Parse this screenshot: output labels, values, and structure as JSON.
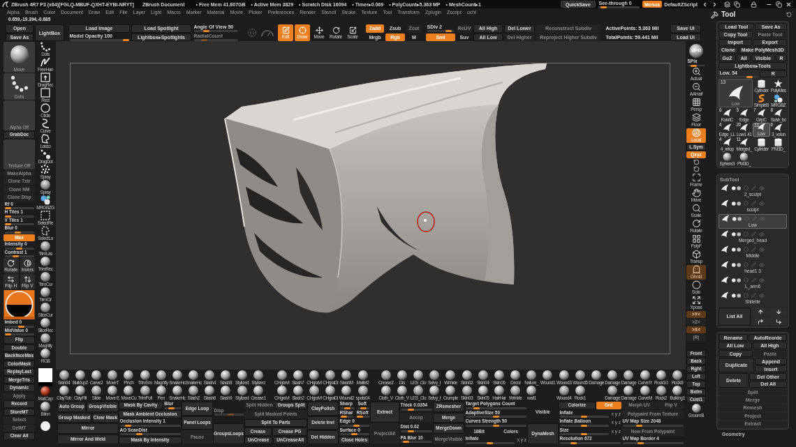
{
  "title_bar": {
    "app_title": "ZBrush 4R7 P3 (x64)[FGLQ-MBUF-QXHT-EYBI-NRYT]",
    "document": "ZBrush Document",
    "stats": [
      "• Free Mem 41.807GB",
      "• Active Mem 3829",
      "• Scratch Disk 16094",
      "• Timer▸0.069",
      "• PolyCount▸5.363 MP",
      "• MeshCount▸1"
    ],
    "quicksave": "QuickSave",
    "see_through": {
      "label": "See-through 0",
      "level": 0.05
    },
    "menus": {
      "label": "Menus",
      "on": true
    },
    "script": "DefaultZScript"
  },
  "menu_bar": [
    "Alpha",
    "Brush",
    "Color",
    "Document",
    "Draw",
    "Edit",
    "File",
    "Layer",
    "Light",
    "Macro",
    "Marker",
    "Material",
    "Movie",
    "Picker",
    "Preferences",
    "Render",
    "Stencil",
    "Stroke",
    "Texture",
    "Tool",
    "Transform",
    "Zplugin",
    "Zscript",
    "ochl"
  ],
  "coordinates": "0.659,-19.394,-0.685",
  "top_shelf": {
    "left": [
      [
        [
          {
            "kind": "button",
            "label": "Open"
          }
        ],
        [
          {
            "kind": "button",
            "label": "Save As"
          }
        ]
      ],
      [
        [
          {
            "kind": "button",
            "label": "LightBox"
          }
        ]
      ],
      [
        [
          {
            "kind": "button",
            "label": "Load Image"
          }
        ],
        [
          {
            "kind": "slider",
            "label": "Model Opacity 100",
            "level": 1
          }
        ]
      ],
      [
        [
          {
            "kind": "button",
            "label": "Load Spotlight"
          }
        ],
        [
          {
            "kind": "button",
            "label": "Lightbox▸Spotlights"
          }
        ]
      ],
      [
        [
          {
            "kind": "slider",
            "label": "Angle Of View 50",
            "level": 0.25
          }
        ],
        [
          {
            "kind": "disabledslider",
            "label": "RadialCount",
            "level": 0.2
          }
        ]
      ]
    ],
    "tools": [
      {
        "label": "Edit",
        "selected": true
      },
      {
        "label": "Draw",
        "selected": true
      },
      {
        "label": "Move",
        "selected": false
      },
      {
        "label": "Rotate",
        "selected": false
      },
      {
        "label": "Scale",
        "selected": false
      }
    ],
    "right": [
      [
        [
          {
            "kind": "active",
            "label": "Zadd"
          }
        ],
        [
          {
            "kind": "plain",
            "label": "Mrgb"
          }
        ]
      ],
      [
        [
          {
            "kind": "plain",
            "label": "Zsub"
          }
        ],
        [
          {
            "kind": "active",
            "label": "Rgb"
          }
        ]
      ],
      [
        [
          {
            "kind": "disabled",
            "label": "Zcut"
          }
        ],
        [
          {
            "kind": "plain",
            "label": "M"
          }
        ]
      ],
      [
        [
          {
            "kind": "slider",
            "label": "SDiv 2",
            "level": 0.9
          }
        ],
        [
          {
            "kind": "active",
            "label": "Smt"
          }
        ]
      ],
      [
        [
          {
            "kind": "disabled",
            "label": "ReUV"
          }
        ],
        [
          {
            "kind": "plain",
            "label": "Suv"
          }
        ]
      ],
      [
        [
          {
            "kind": "button",
            "label": "All High"
          }
        ],
        [
          {
            "kind": "button",
            "label": "All Low"
          }
        ]
      ],
      [
        [
          {
            "kind": "button",
            "label": "Del Lower"
          }
        ],
        [
          {
            "kind": "disabled",
            "label": "Del Higher"
          }
        ]
      ],
      [
        [
          {
            "kind": "disabled",
            "label": "Reconstruct Subdiv"
          }
        ],
        [
          {
            "kind": "disabled",
            "label": "Reproject Higher Subdiv"
          }
        ]
      ],
      [
        [
          {
            "kind": "text",
            "label": "ActivePoints: 5.363 Mil"
          }
        ],
        [
          {
            "kind": "text",
            "label": "TotalPoints: 59.441 Mil"
          }
        ]
      ],
      [
        [
          {
            "kind": "button",
            "label": "Save Ui"
          }
        ],
        [
          {
            "kind": "button",
            "label": "Load Ui"
          }
        ]
      ]
    ]
  },
  "left_shelf": {
    "main": [
      {
        "kind": "brush",
        "label": "Move"
      },
      {
        "kind": "stroke",
        "label": "Dots"
      },
      {
        "kind": "blank",
        "label": "Alpha Off"
      },
      {
        "kind": "button",
        "label": "GrabDoc"
      },
      {
        "kind": "blank",
        "label": "Texture Off"
      },
      {
        "kind": "disabled",
        "label": "MakeAlpha"
      },
      {
        "kind": "disabled",
        "label": "Clone Txtr"
      },
      {
        "kind": "disabled",
        "label": "Clone NM"
      },
      {
        "kind": "disabled",
        "label": "Clone Disp"
      },
      {
        "kind": "slider",
        "label": "Rf 0",
        "level": 0
      },
      {
        "kind": "slider",
        "label": "H Tiles 1",
        "level": 0
      },
      {
        "kind": "slider",
        "label": "V Tiles 1",
        "level": 0
      },
      {
        "kind": "slider",
        "label": "Blur 0",
        "level": 0.45
      },
      {
        "kind": "active",
        "label": "Max"
      },
      {
        "kind": "slider",
        "label": "Intensity 0",
        "level": 0.5
      },
      {
        "kind": "slider",
        "label": "Contrast 1",
        "level": 0.35
      },
      {
        "kind": "icons",
        "items": [
          {
            "label": "Rotate"
          },
          {
            "label": "Invers"
          }
        ]
      },
      {
        "kind": "icons",
        "items": [
          {
            "label": "Flip H"
          },
          {
            "label": "Flip V"
          }
        ]
      },
      {
        "kind": "preview"
      },
      {
        "kind": "slider",
        "label": "Imbed 0",
        "level": 0.6
      },
      {
        "kind": "slider",
        "label": "MidValue 0",
        "level": 0
      },
      {
        "kind": "button",
        "label": "Flip"
      },
      {
        "kind": "button",
        "label": "Double"
      },
      {
        "kind": "button",
        "label": "BackfaceMas"
      },
      {
        "kind": "button",
        "label": "ColorMask"
      },
      {
        "kind": "button",
        "label": "ReplayLast"
      },
      {
        "kind": "button",
        "label": "MergeTris"
      },
      {
        "kind": "button",
        "label": "Dynamic"
      },
      {
        "kind": "disabled",
        "label": "Apply"
      },
      {
        "kind": "button",
        "label": "Record"
      },
      {
        "kind": "button",
        "label": "StoreMT"
      },
      {
        "kind": "disabled",
        "label": "Select"
      },
      {
        "kind": "disabled",
        "label": "DelMT"
      },
      {
        "kind": "button",
        "label": "Clear All"
      }
    ],
    "strokes": [
      {
        "label": "Dots"
      },
      {
        "label": "FreeHan"
      },
      {
        "label": "DragRec"
      },
      {
        "label": "Rect"
      },
      {
        "label": "Circle"
      },
      {
        "label": "Curve"
      },
      {
        "label": "Lasso"
      },
      {
        "label": "DragDot"
      },
      {
        "label": "Spray"
      },
      {
        "label": "Spray"
      },
      {
        "label": "MRGBZG"
      },
      {
        "label": "SelectRe"
      },
      {
        "label": "SelectLa"
      },
      {
        "label": "TrimLas"
      },
      {
        "label": "TrimRec"
      },
      {
        "label": "TrimCur"
      },
      {
        "label": "TrimCir"
      },
      {
        "label": "SliceCur"
      },
      {
        "label": "SliceRec"
      },
      {
        "label": "Magnify"
      },
      {
        "label": "RGB"
      }
    ],
    "materials": [
      {
        "label": "MatCap"
      },
      {
        "label": "Blinn"
      }
    ]
  },
  "right_shelf": [
    {
      "kind": "sphere",
      "label": "BPR"
    },
    {
      "kind": "slider",
      "label": "SPix",
      "level": 0.3
    },
    {
      "kind": "icon",
      "label": "Actual"
    },
    {
      "kind": "icon",
      "label": "AAHalf"
    },
    {
      "kind": "icon",
      "label": "Persp"
    },
    {
      "kind": "icon",
      "label": "Floor"
    },
    {
      "kind": "activeicon",
      "label": "Local"
    },
    {
      "kind": "button",
      "label": "L.Sym"
    },
    {
      "kind": "active",
      "label": "Qxyz"
    },
    {
      "kind": "glyph"
    },
    {
      "kind": "glyph"
    },
    {
      "kind": "icon",
      "label": "Frame"
    },
    {
      "kind": "icon",
      "label": "Move"
    },
    {
      "kind": "icon",
      "label": "Scale"
    },
    {
      "kind": "icon",
      "label": "Rotate"
    },
    {
      "kind": "icon",
      "label": "PolyF"
    },
    {
      "kind": "icon",
      "label": "Transp"
    },
    {
      "kind": "dimicon",
      "label": "Ghost"
    },
    {
      "kind": "icon",
      "label": "Solo"
    },
    {
      "kind": "icon",
      "label": "Xpose"
    },
    {
      "kind": "dimactive",
      "label": ">Y<"
    },
    {
      "kind": "disabled",
      "label": ">Z<"
    },
    {
      "kind": "dimactive",
      "label": ">X<"
    },
    {
      "kind": "disabled",
      "label": "(R)"
    },
    {
      "kind": "button",
      "label": "Front"
    },
    {
      "kind": "button",
      "label": "Back"
    },
    {
      "kind": "button",
      "label": "Rght"
    },
    {
      "kind": "button",
      "label": "Left"
    },
    {
      "kind": "button",
      "label": "Top"
    },
    {
      "kind": "button",
      "label": "Botm"
    },
    {
      "kind": "button",
      "label": "Cust1"
    },
    {
      "kind": "icon",
      "label": "GroomB"
    }
  ],
  "brush_palette": [
    {
      "rows": [
        [
          {
            "kind": "brush",
            "label": "Skin04"
          },
          {
            "kind": "brush",
            "label": "Buildup2"
          },
          {
            "kind": "brush",
            "label": "Carve2"
          },
          {
            "kind": "brush",
            "label": "MoveT"
          },
          {
            "kind": "brush",
            "label": "Pinch"
          },
          {
            "kind": "brush",
            "label": "TrimSm"
          },
          {
            "kind": "brush",
            "label": "Magnify"
          },
          {
            "kind": "brush",
            "label": "SnakeHc"
          },
          {
            "kind": "brush",
            "label": "SnakeHc"
          },
          {
            "kind": "brush",
            "label": "Slash4"
          },
          {
            "kind": "brush",
            "label": "Slash8"
          },
          {
            "kind": "brush",
            "label": "Stylized"
          },
          {
            "kind": "brush",
            "label": "Stylized"
          }
        ],
        [
          {
            "kind": "brush",
            "label": "ClayTub"
          },
          {
            "kind": "brush",
            "label": "ClayFill"
          },
          {
            "kind": "brush",
            "label": "Slide"
          },
          {
            "kind": "brush",
            "label": "Move E"
          },
          {
            "kind": "brush",
            "label": "MoveCu"
          },
          {
            "kind": "brush",
            "label": "TrimPoli"
          },
          {
            "kind": "brush",
            "label": "Pen"
          },
          {
            "kind": "brush",
            "label": "SnakeHc"
          },
          {
            "kind": "brush",
            "label": "Slash2"
          },
          {
            "kind": "brush",
            "label": "Slash6"
          },
          {
            "kind": "brush",
            "label": "Slash9"
          },
          {
            "kind": "brush",
            "label": "Stylized"
          },
          {
            "kind": "brush",
            "label": "Crease1"
          }
        ]
      ]
    },
    {
      "rows": [
        [
          {
            "kind": "brush",
            "label": "CHgraVi"
          },
          {
            "kind": "brush",
            "label": "Slash7"
          },
          {
            "kind": "brush",
            "label": "CHgraVi"
          },
          {
            "kind": "brush",
            "label": "CHgraDi"
          },
          {
            "kind": "brush",
            "label": "SlashM"
          },
          {
            "kind": "brush",
            "label": "Mallet2"
          }
        ],
        [
          {
            "kind": "brush",
            "label": "CHgraVi"
          },
          {
            "kind": "brush",
            "label": "Slash2"
          },
          {
            "kind": "brush",
            "label": "CHgraVi"
          },
          {
            "kind": "brush",
            "label": "CHgraDi"
          },
          {
            "kind": "brush",
            "label": "Wound2"
          },
          {
            "kind": "brush",
            "label": "spots04"
          }
        ]
      ]
    },
    {
      "rows": [
        [
          {
            "kind": "brush",
            "label": "Crease2"
          },
          {
            "kind": "brush",
            "label": "Dis"
          },
          {
            "kind": "brush",
            "label": "LES_Clo"
          },
          {
            "kind": "brush",
            "label": "Selvy_I"
          },
          {
            "kind": "brush",
            "label": "Wrinkle"
          },
          {
            "kind": "brush",
            "label": "Skin02"
          },
          {
            "kind": "brush",
            "label": "Skin04"
          },
          {
            "kind": "brush",
            "label": "Skin06"
          },
          {
            "kind": "brush",
            "label": "Decol"
          },
          {
            "kind": "brush",
            "label": "Nature_"
          },
          {
            "kind": "brush",
            "label": "Wound1"
          },
          {
            "kind": "brush",
            "label": "Wound3"
          },
          {
            "kind": "brush",
            "label": "Wound5"
          },
          {
            "kind": "brush",
            "label": "Damage"
          },
          {
            "kind": "brush",
            "label": "Damage"
          },
          {
            "kind": "brush",
            "label": "Damage"
          },
          {
            "kind": "brush",
            "label": "CurveTr"
          },
          {
            "kind": "brush",
            "label": "Rock10"
          },
          {
            "kind": "brush",
            "label": "Rock8"
          }
        ],
        [
          {
            "kind": "brush",
            "label": "Cloth_V"
          },
          {
            "kind": "brush",
            "label": "Cloth_V"
          },
          {
            "kind": "brush",
            "label": "LES_Clo"
          },
          {
            "kind": "brush",
            "label": "Selvy_I"
          },
          {
            "kind": "brush",
            "label": "Crumple"
          },
          {
            "kind": "brush",
            "label": "Skin03"
          },
          {
            "kind": "brush",
            "label": "Skin05"
          },
          {
            "kind": "brush",
            "label": "HairHar"
          },
          {
            "kind": "brush",
            "label": "Wrinkle"
          },
          {
            "kind": "brush",
            "label": "wall1"
          },
          {
            "kind": "empty"
          },
          {
            "kind": "brush",
            "label": "Wound4"
          },
          {
            "kind": "brush",
            "label": "Rock1"
          },
          {
            "kind": "empty"
          },
          {
            "kind": "brush",
            "label": "Damage"
          },
          {
            "kind": "brush",
            "label": "Damage"
          },
          {
            "kind": "brush",
            "label": "CurveM"
          },
          {
            "kind": "brush",
            "label": "Rock2"
          },
          {
            "kind": "brush",
            "label": "Bulking1"
          }
        ]
      ]
    }
  ],
  "bottom_controls": [
    [
      [
        {
          "kind": "button",
          "label": "Auto Group"
        },
        {
          "kind": "button",
          "label": "GroupVisible"
        }
      ],
      [
        {
          "kind": "button",
          "label": "Group Masked"
        },
        {
          "kind": "button",
          "label": "Clear Mask"
        }
      ],
      [
        {
          "kind": "button",
          "label": "Mirror"
        }
      ],
      [
        {
          "kind": "button",
          "label": "Mirror And Weld"
        }
      ]
    ],
    [
      [
        {
          "kind": "button",
          "label": "Mask By Cavity"
        },
        {
          "kind": "slider",
          "label": "Blur",
          "level": 0.4
        }
      ],
      [
        {
          "kind": "button",
          "label": "Mask Ambient Occlusion"
        }
      ],
      [
        {
          "kind": "slider",
          "label": "Occlusion Intensity 1",
          "level": 0.1
        }
      ],
      [
        {
          "kind": "slider",
          "label": "AO ScanDist",
          "level": 0.3
        }
      ],
      [
        {
          "kind": "button",
          "label": "Mask By Intensity"
        }
      ]
    ],
    [
      [
        {
          "kind": "button",
          "label": "Edge Loop"
        }
      ],
      [
        {
          "kind": "button",
          "label": "Panel Loops"
        }
      ],
      [
        {
          "kind": "disabled",
          "label": "Pause"
        }
      ]
    ],
    [
      [
        {
          "kind": "disabledslider",
          "label": "Disp",
          "level": 0.6
        }
      ],
      [
        {
          "kind": "button",
          "label": "GroupsLoops"
        }
      ]
    ],
    [
      [
        {
          "kind": "disabled",
          "label": "Split Hidden"
        },
        {
          "kind": "button",
          "label": "Groups Split"
        }
      ],
      [
        {
          "kind": "disabled",
          "label": "Split Masked Points"
        }
      ],
      [
        {
          "kind": "button",
          "label": "Split To Parts"
        }
      ],
      [
        {
          "kind": "button",
          "label": "Crease"
        },
        {
          "kind": "button",
          "label": "Crease PG"
        }
      ],
      [
        {
          "kind": "button",
          "label": "UnCrease"
        },
        {
          "kind": "button",
          "label": "UnCreaseAll"
        }
      ]
    ],
    [
      [
        {
          "kind": "button",
          "label": "ClayPolish"
        }
      ],
      [
        {
          "kind": "button",
          "label": "Delete Invi"
        }
      ],
      [
        {
          "kind": "button",
          "label": "Del Hidden"
        }
      ]
    ],
    [
      [
        {
          "kind": "slider",
          "label": "Sharp",
          "level": 0.5
        },
        {
          "kind": "slider",
          "label": "Soft",
          "level": 0.5
        }
      ],
      [
        {
          "kind": "slider",
          "label": "RShar",
          "level": 0.1
        },
        {
          "kind": "slider",
          "label": "RSoft",
          "level": 0.1
        }
      ],
      [
        {
          "kind": "slider",
          "label": "Edge 0",
          "level": 0.6
        }
      ],
      [
        {
          "kind": "slider",
          "label": "Surface 0",
          "level": 0.5
        }
      ],
      [
        {
          "kind": "button",
          "label": "Close Holes"
        }
      ]
    ],
    [
      [
        {
          "kind": "button",
          "label": "Extract"
        }
      ],
      [
        {
          "kind": "disabled",
          "label": "ProjectAll"
        }
      ]
    ],
    [
      [
        {
          "kind": "slider",
          "label": "Thick 0.0354",
          "level": 0.3
        }
      ],
      [
        {
          "kind": "disabled",
          "label": "Accep"
        }
      ],
      [
        {
          "kind": "slider",
          "label": "Dist 0.02",
          "level": 0.3
        }
      ],
      [
        {
          "kind": "slider",
          "label": "PA Blur 10",
          "level": 0.1
        }
      ]
    ],
    [
      [
        {
          "kind": "button",
          "label": "ZRemesher"
        }
      ],
      [
        {
          "kind": "button",
          "label": "Merge"
        }
      ],
      [
        {
          "kind": "button",
          "label": "MergeDown"
        }
      ],
      [
        {
          "kind": "disabled",
          "label": "MergeVisible"
        }
      ]
    ],
    [
      [
        {
          "kind": "slider",
          "label": "Target Polygons Count",
          "level": 0.15
        }
      ],
      [
        {
          "kind": "slider",
          "label": "AdaptiveSize 50",
          "level": 0.5
        }
      ],
      [
        {
          "kind": "slider",
          "label": "Curves Strength 50",
          "level": 0.5
        }
      ],
      [
        {
          "kind": "plain",
          "label": "16Bit"
        },
        {
          "kind": "plain",
          "label": "Colors"
        }
      ],
      [
        {
          "kind": "slider",
          "label": "Inflate",
          "level": 0.5
        },
        {
          "kind": "axes",
          "label": "x y z"
        }
      ]
    ],
    [
      [
        {
          "kind": "plain",
          "label": "Visible"
        }
      ],
      [
        {
          "kind": "button",
          "label": "DynaMesh"
        }
      ]
    ],
    [
      [
        {
          "kind": "button",
          "label": "Colorize"
        },
        {
          "kind": "active",
          "label": "Grd"
        }
      ],
      [
        {
          "kind": "slider",
          "label": "Inflate",
          "level": 0.5
        },
        {
          "kind": "axes",
          "label": "x y z"
        }
      ],
      [
        {
          "kind": "slider",
          "label": "Inflate Balloon",
          "level": 0.5
        },
        {
          "kind": "axes",
          "label": "x y z"
        }
      ],
      [
        {
          "kind": "slider",
          "label": "Size",
          "level": 0.5
        },
        {
          "kind": "axes",
          "label": "x y z"
        }
      ],
      [
        {
          "kind": "slider",
          "label": "Resolution 672",
          "level": 0.2
        }
      ]
    ],
    [
      [
        {
          "kind": "disabled",
          "label": "Morph UV"
        },
        {
          "kind": "disabled",
          "label": "Flip V"
        }
      ],
      [
        {
          "kind": "disabled",
          "label": "Polypaint From Texture"
        }
      ],
      [
        {
          "kind": "slider",
          "label": "UV Map Size 2048",
          "level": 0.25
        }
      ],
      [
        {
          "kind": "disabled",
          "label": "New From Polypaint"
        }
      ],
      [
        {
          "kind": "slider",
          "label": "UV Map Border 4",
          "level": 0.28
        }
      ]
    ]
  ],
  "tool_panel": {
    "title": "Tool",
    "buttons": [
      [
        {
          "kind": "button",
          "label": "Load Tool"
        },
        {
          "kind": "button",
          "label": "Save As"
        }
      ],
      [
        {
          "kind": "button",
          "label": "Copy Tool"
        },
        {
          "kind": "disabled",
          "label": "Paste Tool"
        }
      ],
      [
        {
          "kind": "button",
          "label": "Import"
        },
        {
          "kind": "button",
          "label": "Export"
        }
      ],
      [
        {
          "kind": "button",
          "label": "Clone"
        },
        {
          "kind": "button",
          "label": "Make PolyMesh3D"
        }
      ],
      [
        {
          "kind": "button",
          "label": "GoZ"
        },
        {
          "kind": "button",
          "label": "All"
        },
        {
          "kind": "button",
          "label": "Visible"
        },
        {
          "kind": "button",
          "label": "R"
        }
      ],
      [
        {
          "kind": "button",
          "label": "Lightbox▸Tools"
        }
      ],
      [
        {
          "kind": "slider",
          "label": "Low. 54",
          "level": 0.85
        },
        {
          "kind": "button",
          "label": "R"
        }
      ]
    ],
    "current_tool": {
      "count": "13",
      "label": "Low"
    },
    "tools": [
      {
        "label": "Cylinder",
        "selected": false
      },
      {
        "label": "PolyMes",
        "selected": false
      },
      {
        "label": "SimpleB",
        "selected": false
      },
      {
        "label": "MRGBZ",
        "selected": false
      },
      {
        "count": "6",
        "label": "KukriC",
        "selected": false
      },
      {
        "count": "5",
        "label": "Edge",
        "selected": false
      },
      {
        "count": "7",
        "label": "GripC",
        "selected": false
      },
      {
        "count": "8",
        "label": "Scab_bc",
        "selected": false
      },
      {
        "count": "4",
        "label": "Edge_LL",
        "selected": false
      },
      {
        "count": "20",
        "label": "Low1 41",
        "selected": false
      },
      {
        "count": "13",
        "label": "Low",
        "selected": true
      },
      {
        "count": "6",
        "label": "3_volun",
        "selected": false
      },
      {
        "count": "4",
        "label": "4_retop",
        "selected": false
      },
      {
        "count": "11",
        "label": "Merged_",
        "selected": false
      },
      {
        "label": "Cylinder",
        "selected": false
      },
      {
        "label": "PM3D_",
        "selected": false
      },
      {
        "label": "Sphere3",
        "selected": false
      },
      {
        "label": "PM3D_",
        "selected": false
      }
    ],
    "subtool": {
      "title": "SubTool",
      "items": [
        {
          "label": "2_sculpt",
          "selected": false
        },
        {
          "label": "sculpt",
          "selected": false
        },
        {
          "label": "Low",
          "selected": true
        },
        {
          "label": "Merged_head",
          "selected": false
        },
        {
          "label": "Middle",
          "selected": false
        },
        {
          "label": "head1 3",
          "selected": false
        },
        {
          "label": "L_arm6",
          "selected": false
        },
        {
          "label": "Shilette",
          "selected": false
        }
      ],
      "list_all": "List All",
      "actions": [
        [
          {
            "kind": "button",
            "label": "Rename"
          },
          {
            "kind": "button",
            "label": "AutoReorde"
          }
        ],
        [
          {
            "kind": "button",
            "label": "All Low"
          },
          {
            "kind": "button",
            "label": "All High"
          }
        ],
        [
          {
            "kind": "button",
            "label": "Copy"
          },
          {
            "kind": "disabled",
            "label": "Paste"
          }
        ],
        [
          {
            "kind": "button",
            "label": "Duplicate"
          },
          {
            "stack": [
              {
                "kind": "button",
                "label": "Append"
              },
              {
                "kind": "button",
                "label": "Insert"
              }
            ]
          }
        ],
        [
          {
            "kind": "button",
            "label": "Delete"
          },
          {
            "stack": [
              {
                "kind": "button",
                "label": "Del Other"
              },
              {
                "kind": "button",
                "label": "Del All"
              }
            ]
          }
        ],
        [
          {
            "kind": "disabled",
            "label": "Split"
          }
        ],
        [
          {
            "kind": "disabled",
            "label": "Merge"
          }
        ],
        [
          {
            "kind": "disabled",
            "label": "Remesh"
          }
        ],
        [
          {
            "kind": "disabled",
            "label": "Project"
          }
        ],
        [
          {
            "kind": "disabled",
            "label": "Extract"
          }
        ]
      ]
    },
    "geometry": "Geometry"
  }
}
